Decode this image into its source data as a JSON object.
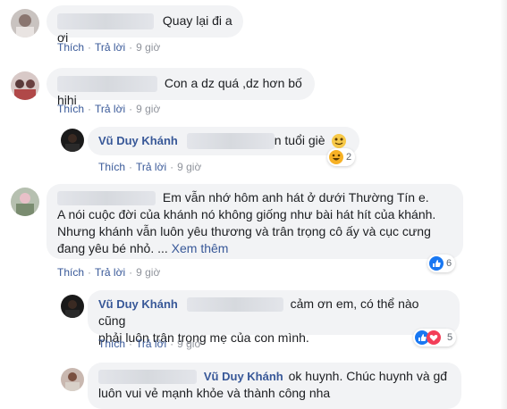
{
  "labels": {
    "like": "Thích",
    "reply": "Trả lời",
    "dot": "·",
    "see_more": "Xem thêm"
  },
  "comments": [
    {
      "text": "Quay lại đi a ơi",
      "time": "9 giờ"
    },
    {
      "text": "Con a dz quá ,dz hơn bố hihi",
      "time": "9 giờ",
      "reply": {
        "author": "Vũ Duy Khánh",
        "text": "n tuổi giè",
        "time": "9 giờ",
        "reaction_count": "2"
      }
    },
    {
      "line1": "Em vẫn nhớ hôm anh hát ở dưới Thường Tín e.",
      "line2": "A nói cuộc đời của khánh nó không giống như bài hát hít của khánh.",
      "line3": "Nhưng khánh vẫn luôn yêu thương và trân trọng cô ấy và cục cưng",
      "line4": "đang yêu bé nhỏ. ...",
      "time": "9 giờ",
      "reaction_count": "6",
      "reply": {
        "author": "Vũ Duy Khánh",
        "line1": "cảm ơn em, có thể nào cũng",
        "line2": "phải luôn trân trọng mẹ của con mình.",
        "time": "9 giờ",
        "reaction_count": "5"
      }
    },
    {
      "author": "Vũ Duy Khánh",
      "line1": "ok huynh. Chúc huynh và gđ",
      "line2": "luôn vui vẻ mạnh khỏe và thành công nha"
    }
  ],
  "colors": {
    "bubble": "#f2f3f5",
    "link": "#385898",
    "like": "#1877f2",
    "love": "#f33e58",
    "haha": "#f7b125"
  }
}
